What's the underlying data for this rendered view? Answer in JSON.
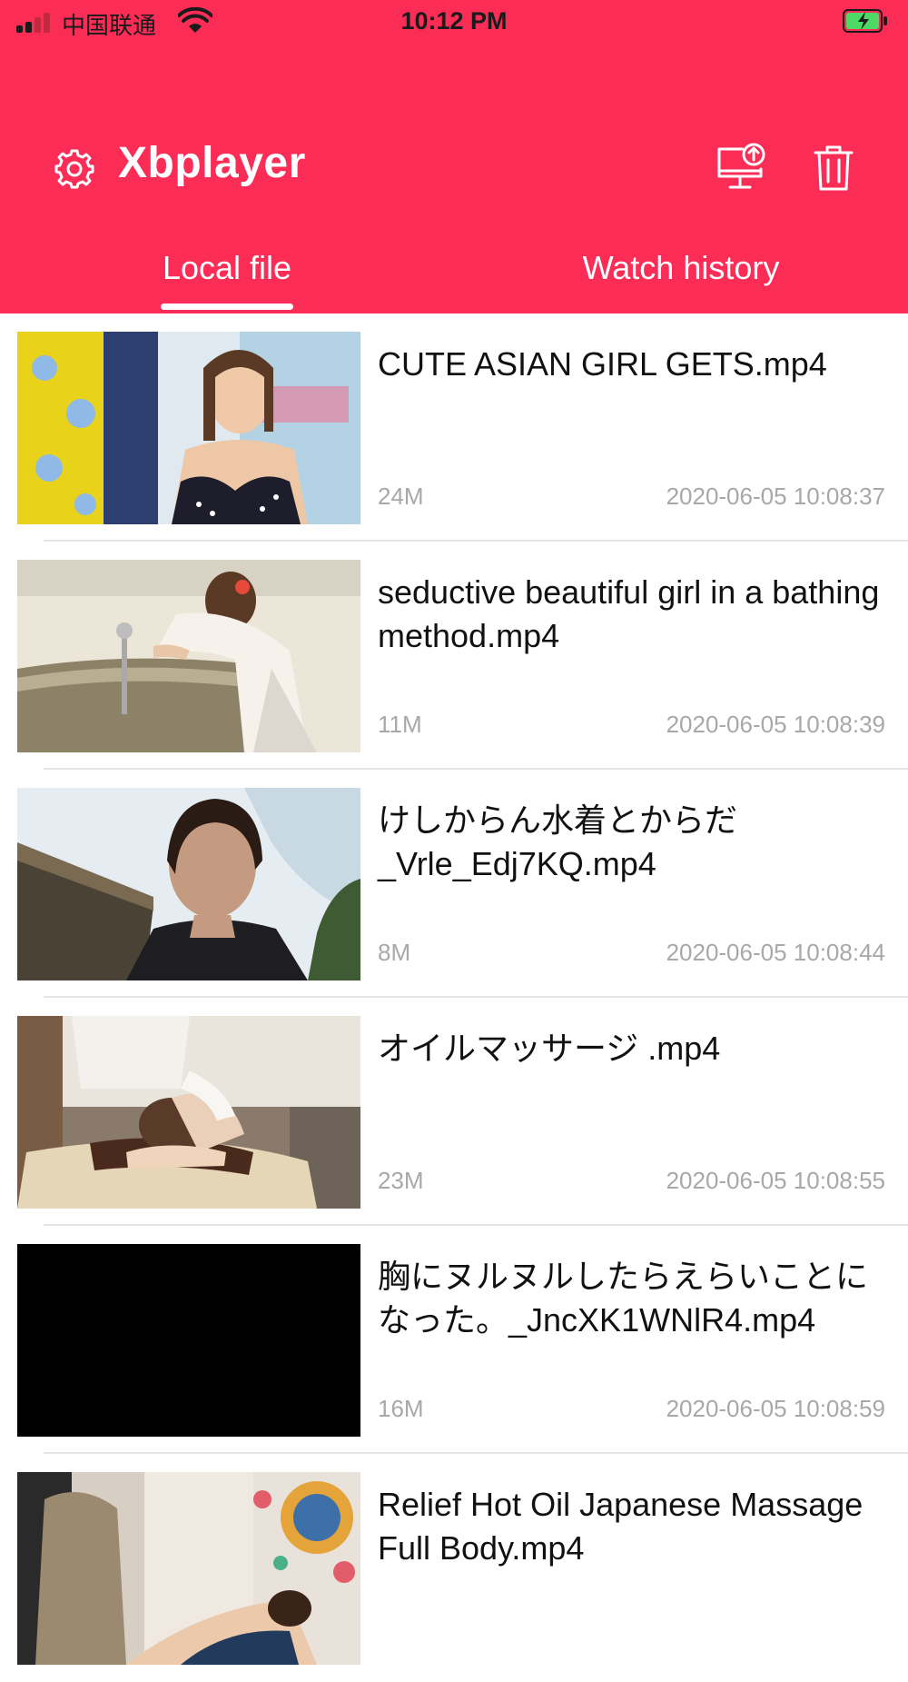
{
  "status_bar": {
    "carrier": "中国联通",
    "time": "10:12 PM"
  },
  "header": {
    "app_title": "Xbplayer",
    "accent_color": "#fb2c56",
    "tabs": [
      {
        "label": "Local file",
        "active": true
      },
      {
        "label": "Watch history",
        "active": false
      }
    ],
    "icons": [
      "gear-icon",
      "cast-upload-icon",
      "trash-icon"
    ]
  },
  "files": [
    {
      "title": "CUTE ASIAN GIRL GETS.mp4",
      "size": "24M",
      "date": "2020-06-05 10:08:37"
    },
    {
      "title": "seductive beautiful girl in a bathing method.mp4",
      "size": "11M",
      "date": "2020-06-05 10:08:39"
    },
    {
      "title": "けしからん水着とからだ_Vrle_Edj7KQ.mp4",
      "size": "8M",
      "date": "2020-06-05 10:08:44"
    },
    {
      "title": "オイルマッサージ .mp4",
      "size": "23M",
      "date": "2020-06-05 10:08:55"
    },
    {
      "title": "胸にヌルヌルしたらえらいことになった。_JncXK1WNlR4.mp4",
      "size": "16M",
      "date": "2020-06-05 10:08:59"
    },
    {
      "title": "Relief Hot Oil Japanese Massage Full Body.mp4",
      "size": "",
      "date": ""
    }
  ]
}
